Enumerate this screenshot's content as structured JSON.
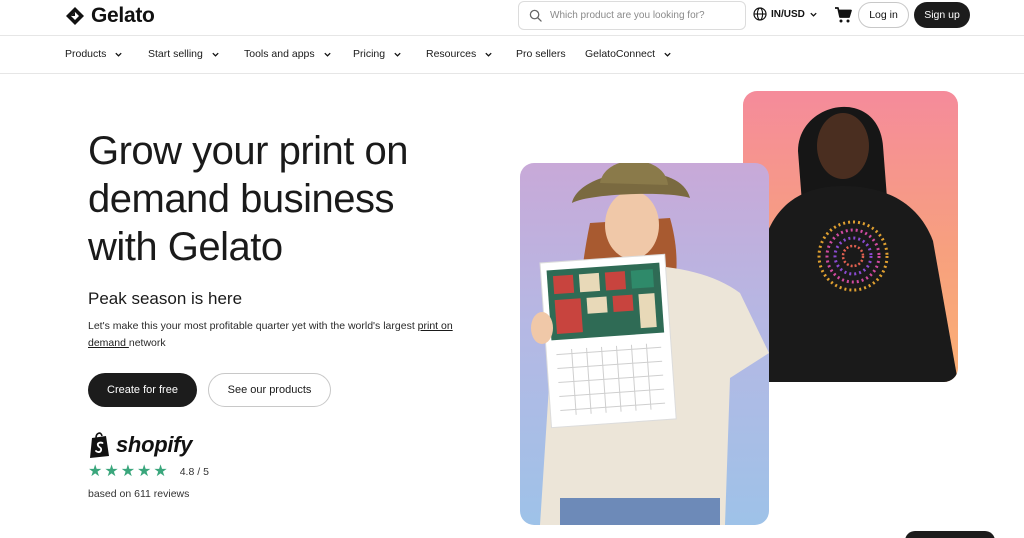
{
  "brand": {
    "name": "Gelato"
  },
  "header": {
    "search_placeholder": "Which product are you looking for?",
    "locale": "IN/USD",
    "login_label": "Log in",
    "signup_label": "Sign up"
  },
  "nav": [
    {
      "label": "Products",
      "dropdown": true
    },
    {
      "label": "Start selling",
      "dropdown": true
    },
    {
      "label": "Tools and apps",
      "dropdown": true
    },
    {
      "label": "Pricing",
      "dropdown": true
    },
    {
      "label": "Resources",
      "dropdown": true
    },
    {
      "label": "Pro sellers",
      "dropdown": false
    },
    {
      "label": "GelatoConnect",
      "dropdown": true
    }
  ],
  "hero": {
    "title_lines": [
      "Grow your print on",
      "demand business",
      "with Gelato"
    ],
    "subtitle": "Peak season is here",
    "desc_before": "Let's make this your most profitable quarter yet with the world's largest ",
    "desc_link": "print on demand ",
    "desc_after": "network",
    "cta_primary": "Create for free",
    "cta_secondary": "See our products"
  },
  "social_proof": {
    "platform": "shopify",
    "stars": 5,
    "rating": "4.8 / 5",
    "reviews": "based on 611 reviews"
  },
  "colors": {
    "accent_dark": "#1c1c1c",
    "star_green": "#3aa67c",
    "card_back": "#f58b9b",
    "card_front": "#b5b8e4"
  }
}
